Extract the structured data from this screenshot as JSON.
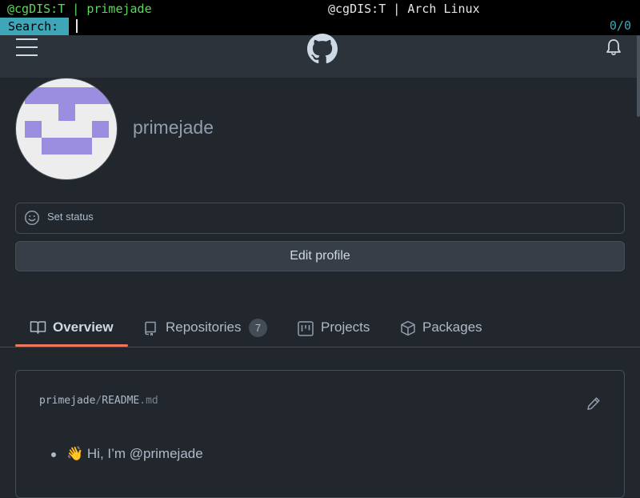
{
  "terminal": {
    "left_title": "@cgDIS:T | primejade",
    "center_title": "@cgDIS:T | Arch Linux",
    "search_label": "Search:",
    "match_count": "0/0"
  },
  "header": {
    "menu_icon": "hamburger-icon",
    "logo_icon": "github-logo-icon",
    "notifications_icon": "bell-icon"
  },
  "profile": {
    "username": "primejade",
    "status_placeholder": "Set status",
    "edit_button": "Edit profile"
  },
  "tabs": [
    {
      "label": "Overview",
      "icon": "book-icon",
      "active": true
    },
    {
      "label": "Repositories",
      "icon": "repo-icon",
      "count": "7"
    },
    {
      "label": "Projects",
      "icon": "project-icon"
    },
    {
      "label": "Packages",
      "icon": "package-icon"
    }
  ],
  "readme": {
    "owner": "primejade",
    "separator": "/",
    "file_base": "README",
    "file_ext": ".md",
    "lines": [
      "👋 Hi, I’m @primejade"
    ]
  },
  "colors": {
    "background": "#22272e",
    "header": "#2d333b",
    "accent_underline": "#ec775c",
    "avatar_identicon": "#9b8ee0"
  }
}
